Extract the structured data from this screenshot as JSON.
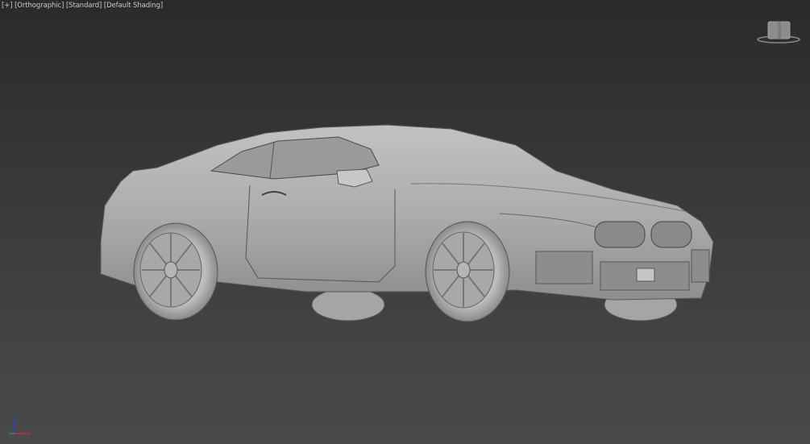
{
  "viewport": {
    "menu_plus": "[+]",
    "view_mode": "[Orthographic]",
    "display_mode": "[Standard]",
    "shading_mode": "[Default Shading]"
  },
  "axis": {
    "x": "X",
    "y": "Y",
    "z": "Z"
  },
  "colors": {
    "x_axis": "#c03030",
    "y_axis": "#30a030",
    "z_axis": "#3040c0",
    "model": "#b4b4b4"
  }
}
